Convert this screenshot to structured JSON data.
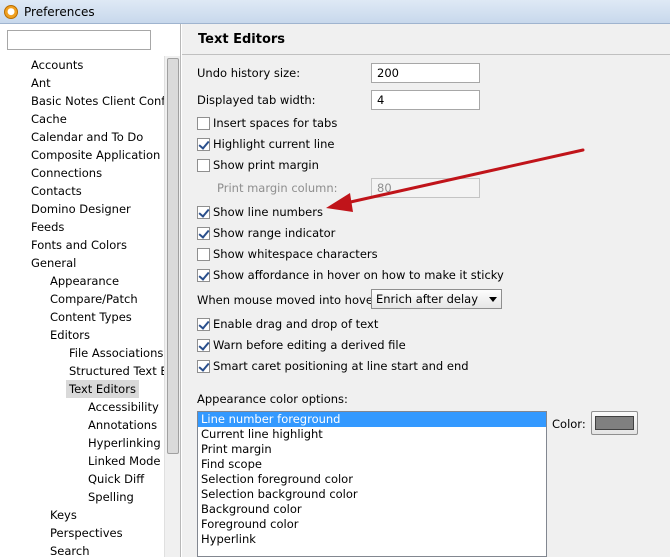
{
  "window": {
    "title": "Preferences"
  },
  "tree": {
    "items": [
      {
        "label": "Accounts",
        "level": 0
      },
      {
        "label": "Ant",
        "level": 0
      },
      {
        "label": "Basic Notes Client Config",
        "level": 0
      },
      {
        "label": "Cache",
        "level": 0
      },
      {
        "label": "Calendar and To Do",
        "level": 0
      },
      {
        "label": "Composite Application E",
        "level": 0
      },
      {
        "label": "Connections",
        "level": 0
      },
      {
        "label": "Contacts",
        "level": 0
      },
      {
        "label": "Domino Designer",
        "level": 0
      },
      {
        "label": "Feeds",
        "level": 0
      },
      {
        "label": "Fonts and Colors",
        "level": 0
      },
      {
        "label": "General",
        "level": 0
      },
      {
        "label": "Appearance",
        "level": 1
      },
      {
        "label": "Compare/Patch",
        "level": 1
      },
      {
        "label": "Content Types",
        "level": 1
      },
      {
        "label": "Editors",
        "level": 1
      },
      {
        "label": "File Associations",
        "level": 2
      },
      {
        "label": "Structured Text Ec",
        "level": 2
      },
      {
        "label": "Text Editors",
        "level": 2,
        "selected": true
      },
      {
        "label": "Accessibility",
        "level": 3
      },
      {
        "label": "Annotations",
        "level": 3
      },
      {
        "label": "Hyperlinking",
        "level": 3
      },
      {
        "label": "Linked Mode",
        "level": 3
      },
      {
        "label": "Quick Diff",
        "level": 3
      },
      {
        "label": "Spelling",
        "level": 3
      },
      {
        "label": "Keys",
        "level": 1
      },
      {
        "label": "Perspectives",
        "level": 1
      },
      {
        "label": "Search",
        "level": 1
      }
    ]
  },
  "page": {
    "title": "Text Editors",
    "undo_label": "Undo history size:",
    "undo_value": "200",
    "tab_label": "Displayed tab width:",
    "tab_value": "4",
    "checkboxes": {
      "insert_spaces": {
        "label": "Insert spaces for tabs",
        "checked": false
      },
      "highlight_line": {
        "label": "Highlight current line",
        "checked": true
      },
      "print_margin": {
        "label": "Show print margin",
        "checked": false
      },
      "line_numbers": {
        "label": "Show line numbers",
        "checked": true
      },
      "range_indicator": {
        "label": "Show range indicator",
        "checked": true
      },
      "whitespace": {
        "label": "Show whitespace characters",
        "checked": false
      },
      "affordance": {
        "label": "Show affordance in hover on how to make it sticky",
        "checked": true
      },
      "drag_drop": {
        "label": "Enable drag and drop of text",
        "checked": true
      },
      "warn_derived": {
        "label": "Warn before editing a derived file",
        "checked": true
      },
      "smart_caret": {
        "label": "Smart caret positioning at line start and end",
        "checked": true
      }
    },
    "print_margin_label": "Print margin column:",
    "print_margin_value": "80",
    "hover_label": "When mouse moved into hover:",
    "hover_value": "Enrich after delay",
    "appearance_label": "Appearance color options:",
    "color_options": [
      "Line number foreground",
      "Current line highlight",
      "Print margin",
      "Find scope",
      "Selection foreground color",
      "Selection background color",
      "Background color",
      "Foreground color",
      "Hyperlink"
    ],
    "color_label": "Color:",
    "swatch_color": "#808080"
  },
  "annotation": {
    "arrow_color": "#c0141a"
  }
}
